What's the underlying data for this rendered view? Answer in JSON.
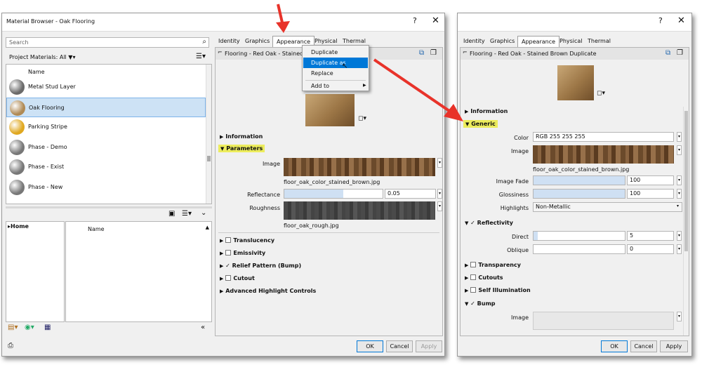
{
  "left": {
    "title": "Material Browser - Oak Flooring",
    "help": "?",
    "close": "✕",
    "search_placeholder": "Search",
    "project_materials": "Project Materials: All",
    "col_name": "Name",
    "materials": [
      {
        "name": "Metal Stud Layer",
        "swatch": "#6a6a6a"
      },
      {
        "name": "Oak Flooring",
        "swatch": "#b08a55"
      },
      {
        "name": "Parking Stripe",
        "swatch": "#e0a820"
      },
      {
        "name": "Phase - Demo",
        "swatch": "#777777"
      },
      {
        "name": "Phase - Exist",
        "swatch": "#777777"
      },
      {
        "name": "Phase - New",
        "swatch": "#777777"
      }
    ],
    "home": "Home",
    "lib_name": "Name"
  },
  "mid": {
    "tabs": [
      "Identity",
      "Graphics",
      "Appearance",
      "Physical",
      "Thermal"
    ],
    "asset_name": "Flooring - Red Oak - Stained",
    "menu": {
      "items": [
        "Duplicate",
        "Duplicate as Generic",
        "Replace",
        "Add to"
      ]
    },
    "sections": {
      "information": "Information",
      "parameters": "Parameters",
      "translucency": "Translucency",
      "emissivity": "Emissivity",
      "relief": "Relief Pattern (Bump)",
      "cutout": "Cutout",
      "advanced": "Advanced Highlight Controls"
    },
    "image_label": "Image",
    "image_file": "floor_oak_color_stained_brown.jpg",
    "reflectance_label": "Reflectance",
    "reflectance_value": "0.05",
    "reflectance_fraction": 0.05,
    "roughness_label": "Roughness",
    "roughness_file": "floor_oak_rough.jpg",
    "ok": "OK",
    "cancel": "Cancel",
    "apply": "Apply"
  },
  "right": {
    "help": "?",
    "close": "✕",
    "tabs": [
      "Identity",
      "Graphics",
      "Appearance",
      "Physical",
      "Thermal"
    ],
    "asset_name": "Flooring - Red Oak - Stained Brown Duplicate",
    "sections": {
      "information": "Information",
      "generic": "Generic",
      "reflectivity": "Reflectivity",
      "transparency": "Transparency",
      "cutouts": "Cutouts",
      "self_illum": "Self Illumination",
      "bump": "Bump"
    },
    "color_label": "Color",
    "color_value": "RGB 255 255 255",
    "image_label": "Image",
    "image_file": "floor_oak_color_stained_brown.jpg",
    "image_fade_label": "Image Fade",
    "image_fade_value": "100",
    "glossiness_label": "Glossiness",
    "glossiness_value": "100",
    "highlights_label": "Highlights",
    "highlights_value": "Non-Metallic",
    "direct_label": "Direct",
    "direct_value": "5",
    "oblique_label": "Oblique",
    "oblique_value": "0",
    "bump_image_label": "Image",
    "ok": "OK",
    "cancel": "Cancel",
    "apply": "Apply"
  },
  "colors": {
    "arrow": "#e8332a",
    "highlight": "#ecec5c",
    "selection": "#cde2f5",
    "menu_hl": "#0078d7"
  }
}
